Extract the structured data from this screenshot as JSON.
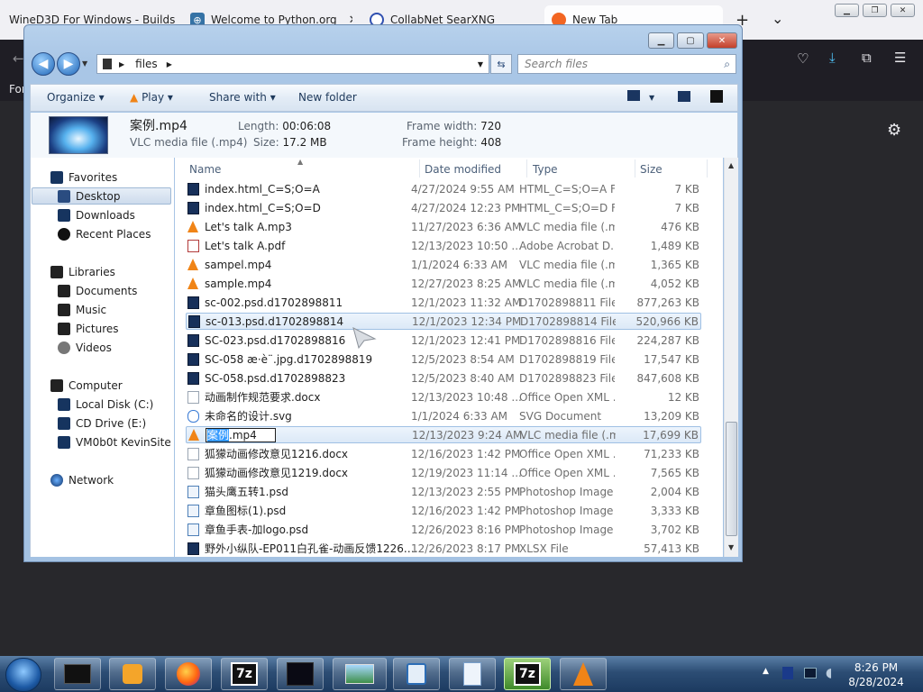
{
  "browser": {
    "tabs": [
      {
        "title": "WineD3D For Windows - Builds"
      },
      {
        "title": "Welcome to Python.org"
      },
      {
        "title": "CollabNet SearXNG"
      },
      {
        "title": "New Tab"
      }
    ],
    "new_tab_label": "+",
    "tab_list_label": "⌄",
    "sidebar_label": "For"
  },
  "explorer": {
    "breadcrumb": [
      "files"
    ],
    "search_placeholder": "Search files",
    "toolbar": {
      "organize": "Organize",
      "play": "Play",
      "share_with": "Share with",
      "new_folder": "New folder"
    },
    "details": {
      "filename": "案例.mp4",
      "filetype": "VLC media file (.mp4)",
      "length_label": "Length:",
      "length": "00:06:08",
      "size_label": "Size:",
      "size": "17.2 MB",
      "frame_width_label": "Frame width:",
      "frame_width": "720",
      "frame_height_label": "Frame height:",
      "frame_height": "408"
    },
    "nav": {
      "favorites": "Favorites",
      "desktop": "Desktop",
      "downloads": "Downloads",
      "recent_places": "Recent Places",
      "libraries": "Libraries",
      "documents": "Documents",
      "music": "Music",
      "pictures": "Pictures",
      "videos": "Videos",
      "computer": "Computer",
      "local_disk": "Local Disk (C:)",
      "cd_drive": "CD Drive (E:)",
      "vm_share": "VM0b0t KevinSite",
      "network": "Network"
    },
    "columns": {
      "name": "Name",
      "date": "Date modified",
      "type": "Type",
      "size": "Size"
    },
    "files": [
      {
        "icon": "blk",
        "name": "index.html_C=S;O=A",
        "date": "4/27/2024 9:55 AM",
        "type": "HTML_C=S;O=A F...",
        "size": "7 KB"
      },
      {
        "icon": "blk",
        "name": "index.html_C=S;O=D",
        "date": "4/27/2024 12:23 PM",
        "type": "HTML_C=S;O=D F...",
        "size": "7 KB"
      },
      {
        "icon": "vlc",
        "name": "Let's talk A.mp3",
        "date": "11/27/2023 6:36 AM",
        "type": "VLC media file (.m...",
        "size": "476 KB"
      },
      {
        "icon": "pdf",
        "name": "Let's talk A.pdf",
        "date": "12/13/2023 10:50 ...",
        "type": "Adobe Acrobat D...",
        "size": "1,489 KB"
      },
      {
        "icon": "vlc",
        "name": "sampel.mp4",
        "date": "1/1/2024 6:33 AM",
        "type": "VLC media file (.m...",
        "size": "1,365 KB"
      },
      {
        "icon": "vlc",
        "name": "sample.mp4",
        "date": "12/27/2023 8:25 AM",
        "type": "VLC media file (.m...",
        "size": "4,052 KB"
      },
      {
        "icon": "blk",
        "name": "sc-002.psd.d1702898811",
        "date": "12/1/2023 11:32 AM",
        "type": "D1702898811 File",
        "size": "877,263 KB"
      },
      {
        "icon": "blk",
        "name": "sc-013.psd.d1702898814",
        "date": "12/1/2023 12:34 PM",
        "type": "D1702898814 File",
        "size": "520,966 KB"
      },
      {
        "icon": "blk",
        "name": "SC-023.psd.d1702898816",
        "date": "12/1/2023 12:41 PM",
        "type": "D1702898816 File",
        "size": "224,287 KB"
      },
      {
        "icon": "blk",
        "name": "SC-058 æ·è¨.jpg.d1702898819",
        "date": "12/5/2023 8:54 AM",
        "type": "D1702898819 File",
        "size": "17,547 KB"
      },
      {
        "icon": "blk",
        "name": "SC-058.psd.d1702898823",
        "date": "12/5/2023 8:40 AM",
        "type": "D1702898823 File",
        "size": "847,608 KB"
      },
      {
        "icon": "doc",
        "name": "动画制作规范要求.docx",
        "date": "12/13/2023 10:48 ...",
        "type": "Office Open XML ...",
        "size": "12 KB"
      },
      {
        "icon": "svg",
        "name": "未命名的设计.svg",
        "date": "1/1/2024 6:33 AM",
        "type": "SVG Document",
        "size": "13,209 KB"
      },
      {
        "icon": "vlc",
        "name": "案例.mp4",
        "rename_selected": "案例",
        "rename_rest": ".mp4",
        "date": "12/13/2023 9:24 AM",
        "type": "VLC media file (.m...",
        "size": "17,699 KB"
      },
      {
        "icon": "doc",
        "name": "狐獴动画修改意见1216.docx",
        "date": "12/16/2023 1:42 PM",
        "type": "Office Open XML ...",
        "size": "71,233 KB"
      },
      {
        "icon": "doc",
        "name": "狐獴动画修改意见1219.docx",
        "date": "12/19/2023 11:14 ...",
        "type": "Office Open XML ...",
        "size": "7,565 KB"
      },
      {
        "icon": "ps",
        "name": "猫头鹰五转1.psd",
        "date": "12/13/2023 2:55 PM",
        "type": "Photoshop Image",
        "size": "2,004 KB"
      },
      {
        "icon": "ps",
        "name": "章鱼图标(1).psd",
        "date": "12/16/2023 1:42 PM",
        "type": "Photoshop Image",
        "size": "3,333 KB"
      },
      {
        "icon": "ps",
        "name": "章鱼手表-加logo.psd",
        "date": "12/26/2023 8:16 PM",
        "type": "Photoshop Image",
        "size": "3,702 KB"
      },
      {
        "icon": "blk",
        "name": "野外小纵队-EP011白孔雀-动画反馈1226.x...",
        "date": "12/26/2023 8:17 PM",
        "type": "XLSX File",
        "size": "57,413 KB"
      }
    ]
  },
  "taskbar": {
    "time": "8:26 PM",
    "date": "8/28/2024"
  },
  "colors": {
    "taskbar": "#2c4d74",
    "explorer_frame": "#a9c6e6",
    "selection": "#3399ff"
  }
}
